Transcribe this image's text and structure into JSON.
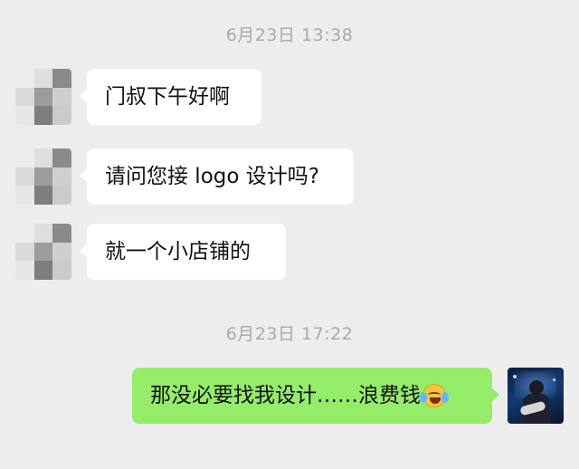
{
  "timestamps": [
    "6月23日 13:38",
    "6月23日 17:22"
  ],
  "colors": {
    "background": "#ededed",
    "incoming_bubble": "#ffffff",
    "outgoing_bubble": "#95ec69",
    "timestamp_text": "#a9a9a9"
  },
  "avatar_mosaic": [
    "#ececec",
    "#dedede",
    "#8a8a8a",
    "#d9d9d9",
    "#9c9c9c",
    "#cfcfcf",
    "#e6e6e6",
    "#7e7e7e",
    "#cbcbcb"
  ],
  "messages": [
    {
      "side": "incoming",
      "text": "门叔下午好啊"
    },
    {
      "side": "incoming",
      "text": "请问您接 logo 设计吗?"
    },
    {
      "side": "incoming",
      "text": "就一个小店铺的"
    },
    {
      "side": "outgoing",
      "text": "那没必要找我设计……浪费钱",
      "emoji": "crying-laughing-emoji"
    }
  ]
}
